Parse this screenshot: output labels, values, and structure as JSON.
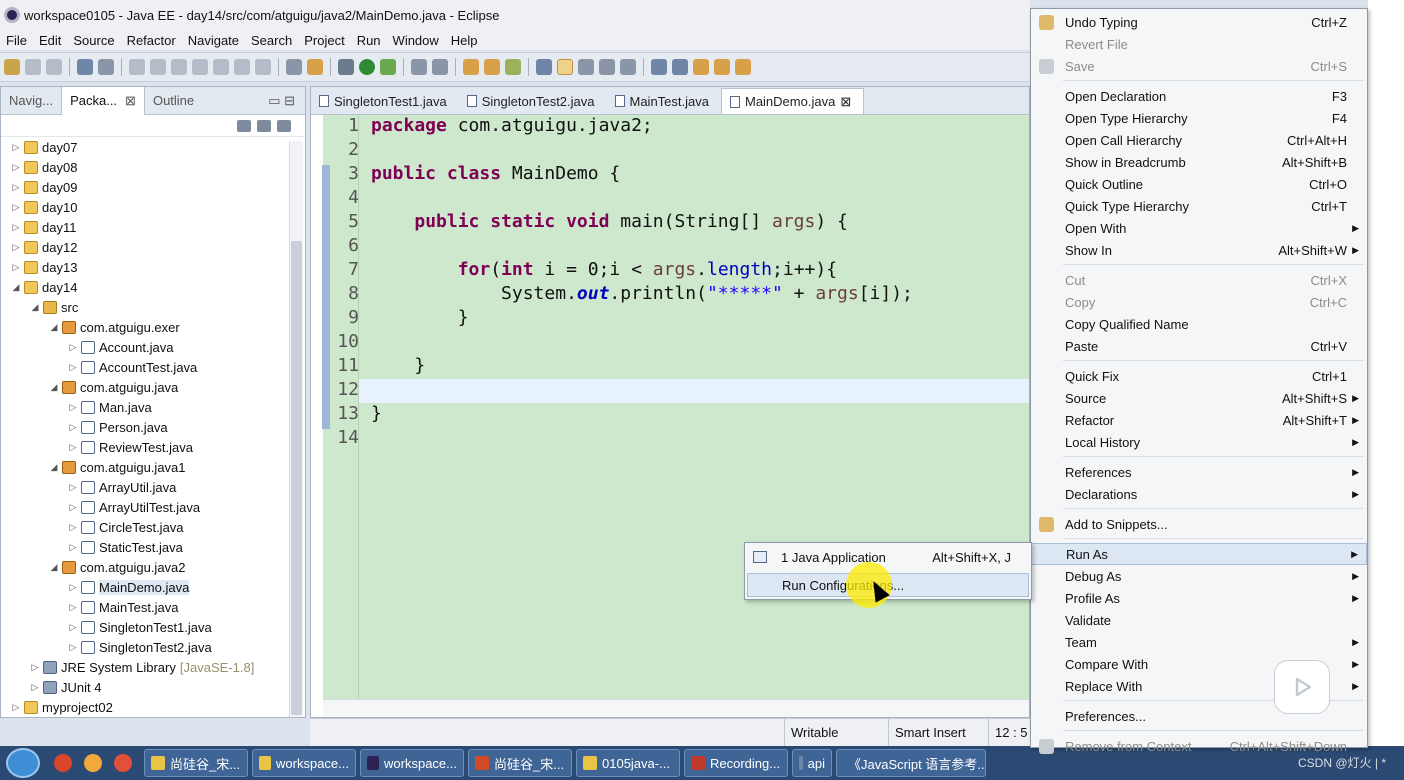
{
  "window": {
    "title": "workspace0105 - Java EE - day14/src/com/atguigu/java2/MainDemo.java - Eclipse"
  },
  "menubar": [
    "File",
    "Edit",
    "Source",
    "Refactor",
    "Navigate",
    "Search",
    "Project",
    "Run",
    "Window",
    "Help"
  ],
  "left_tabs": [
    {
      "label": "Navig...",
      "active": false
    },
    {
      "label": "Packa...",
      "active": true,
      "close": "⊠"
    },
    {
      "label": "Outline",
      "active": false
    }
  ],
  "tree": [
    {
      "depth": 0,
      "arrow": "▷",
      "icon": "proj",
      "label": "day07"
    },
    {
      "depth": 0,
      "arrow": "▷",
      "icon": "proj",
      "label": "day08"
    },
    {
      "depth": 0,
      "arrow": "▷",
      "icon": "proj",
      "label": "day09"
    },
    {
      "depth": 0,
      "arrow": "▷",
      "icon": "proj",
      "label": "day10"
    },
    {
      "depth": 0,
      "arrow": "▷",
      "icon": "proj",
      "label": "day11"
    },
    {
      "depth": 0,
      "arrow": "▷",
      "icon": "proj",
      "label": "day12"
    },
    {
      "depth": 0,
      "arrow": "▷",
      "icon": "proj",
      "label": "day13"
    },
    {
      "depth": 0,
      "arrow": "◢",
      "icon": "proj",
      "label": "day14"
    },
    {
      "depth": 1,
      "arrow": "◢",
      "icon": "src",
      "label": "src"
    },
    {
      "depth": 2,
      "arrow": "◢",
      "icon": "pkg",
      "label": "com.atguigu.exer"
    },
    {
      "depth": 3,
      "arrow": "▷",
      "icon": "java",
      "label": "Account.java"
    },
    {
      "depth": 3,
      "arrow": "▷",
      "icon": "java",
      "label": "AccountTest.java"
    },
    {
      "depth": 2,
      "arrow": "◢",
      "icon": "pkg",
      "label": "com.atguigu.java"
    },
    {
      "depth": 3,
      "arrow": "▷",
      "icon": "java",
      "label": "Man.java"
    },
    {
      "depth": 3,
      "arrow": "▷",
      "icon": "java",
      "label": "Person.java"
    },
    {
      "depth": 3,
      "arrow": "▷",
      "icon": "java",
      "label": "ReviewTest.java"
    },
    {
      "depth": 2,
      "arrow": "◢",
      "icon": "pkg",
      "label": "com.atguigu.java1"
    },
    {
      "depth": 3,
      "arrow": "▷",
      "icon": "java",
      "label": "ArrayUtil.java"
    },
    {
      "depth": 3,
      "arrow": "▷",
      "icon": "java",
      "label": "ArrayUtilTest.java"
    },
    {
      "depth": 3,
      "arrow": "▷",
      "icon": "java",
      "label": "CircleTest.java"
    },
    {
      "depth": 3,
      "arrow": "▷",
      "icon": "java",
      "label": "StaticTest.java"
    },
    {
      "depth": 2,
      "arrow": "◢",
      "icon": "pkg",
      "label": "com.atguigu.java2"
    },
    {
      "depth": 3,
      "arrow": "▷",
      "icon": "java",
      "label": "MainDemo.java",
      "selected": true
    },
    {
      "depth": 3,
      "arrow": "▷",
      "icon": "java",
      "label": "MainTest.java"
    },
    {
      "depth": 3,
      "arrow": "▷",
      "icon": "java",
      "label": "SingletonTest1.java"
    },
    {
      "depth": 3,
      "arrow": "▷",
      "icon": "java",
      "label": "SingletonTest2.java"
    },
    {
      "depth": 1,
      "arrow": "▷",
      "icon": "lib",
      "label": "JRE System Library",
      "suffix": "[JavaSE-1.8]"
    },
    {
      "depth": 1,
      "arrow": "▷",
      "icon": "lib",
      "label": "JUnit 4"
    },
    {
      "depth": 0,
      "arrow": "▷",
      "icon": "proj",
      "label": "myproject02"
    }
  ],
  "editor_tabs": [
    {
      "label": "SingletonTest1.java",
      "active": false
    },
    {
      "label": "SingletonTest2.java",
      "active": false
    },
    {
      "label": "MainTest.java",
      "active": false
    },
    {
      "label": "MainDemo.java",
      "active": true,
      "close": "⊠"
    }
  ],
  "code_lines": [
    "1",
    "2",
    "3",
    "4",
    "5",
    "6",
    "7",
    "8",
    "9",
    "10",
    "11",
    "12",
    "13",
    "14"
  ],
  "status": {
    "writable": "Writable",
    "insert": "Smart Insert",
    "position": "12 : 5"
  },
  "context_menu": [
    {
      "label": "Undo Typing",
      "shortcut": "Ctrl+Z",
      "icon": true
    },
    {
      "label": "Revert File",
      "disabled": true
    },
    {
      "label": "Save",
      "shortcut": "Ctrl+S",
      "disabled": true,
      "icon": true
    },
    {
      "sep": true
    },
    {
      "label": "Open Declaration",
      "shortcut": "F3"
    },
    {
      "label": "Open Type Hierarchy",
      "shortcut": "F4"
    },
    {
      "label": "Open Call Hierarchy",
      "shortcut": "Ctrl+Alt+H"
    },
    {
      "label": "Show in Breadcrumb",
      "shortcut": "Alt+Shift+B"
    },
    {
      "label": "Quick Outline",
      "shortcut": "Ctrl+O"
    },
    {
      "label": "Quick Type Hierarchy",
      "shortcut": "Ctrl+T"
    },
    {
      "label": "Open With",
      "submenu": true
    },
    {
      "label": "Show In",
      "shortcut": "Alt+Shift+W",
      "submenu": true
    },
    {
      "sep": true
    },
    {
      "label": "Cut",
      "shortcut": "Ctrl+X",
      "disabled": true
    },
    {
      "label": "Copy",
      "shortcut": "Ctrl+C",
      "disabled": true
    },
    {
      "label": "Copy Qualified Name"
    },
    {
      "label": "Paste",
      "shortcut": "Ctrl+V"
    },
    {
      "sep": true
    },
    {
      "label": "Quick Fix",
      "shortcut": "Ctrl+1"
    },
    {
      "label": "Source",
      "shortcut": "Alt+Shift+S",
      "submenu": true
    },
    {
      "label": "Refactor",
      "shortcut": "Alt+Shift+T",
      "submenu": true
    },
    {
      "label": "Local History",
      "submenu": true
    },
    {
      "sep": true
    },
    {
      "label": "References",
      "submenu": true
    },
    {
      "label": "Declarations",
      "submenu": true
    },
    {
      "sep": true
    },
    {
      "label": "Add to Snippets...",
      "icon": true
    },
    {
      "sep": true
    },
    {
      "label": "Run As",
      "submenu": true,
      "highlight": true
    },
    {
      "label": "Debug As",
      "submenu": true
    },
    {
      "label": "Profile As",
      "submenu": true
    },
    {
      "label": "Validate"
    },
    {
      "label": "Team",
      "submenu": true
    },
    {
      "label": "Compare With",
      "submenu": true
    },
    {
      "label": "Replace With",
      "submenu": true
    },
    {
      "sep": true
    },
    {
      "label": "Preferences..."
    },
    {
      "sep": true
    },
    {
      "label": "Remove from Context",
      "shortcut": "Ctrl+Alt+Shift+Down",
      "disabled": true,
      "icon": true
    }
  ],
  "submenu": [
    {
      "label": "1 Java Application",
      "shortcut": "Alt+Shift+X, J"
    },
    {
      "label": "Run Configurations...",
      "highlight": true
    }
  ],
  "taskbar": [
    {
      "label": "尚硅谷_宋...",
      "color": "#e8c547"
    },
    {
      "label": "workspace...",
      "color": "#e8c547"
    },
    {
      "label": "workspace...",
      "color": "#2c2255"
    },
    {
      "label": "尚硅谷_宋...",
      "color": "#d04a26"
    },
    {
      "label": "0105java-...",
      "color": "#e8c547"
    },
    {
      "label": "Recording...",
      "color": "#c0392b"
    },
    {
      "label": "api",
      "color": "#6f86a8"
    },
    {
      "label": "《JavaScript 语言参考...",
      "color": "#e8c547"
    }
  ],
  "watermark": "CSDN @灯火 | *",
  "colors": {
    "keyword": "#7f0055",
    "field": "#0000c0",
    "string": "#2a00ff",
    "editor_bg": "#cde8cc"
  }
}
